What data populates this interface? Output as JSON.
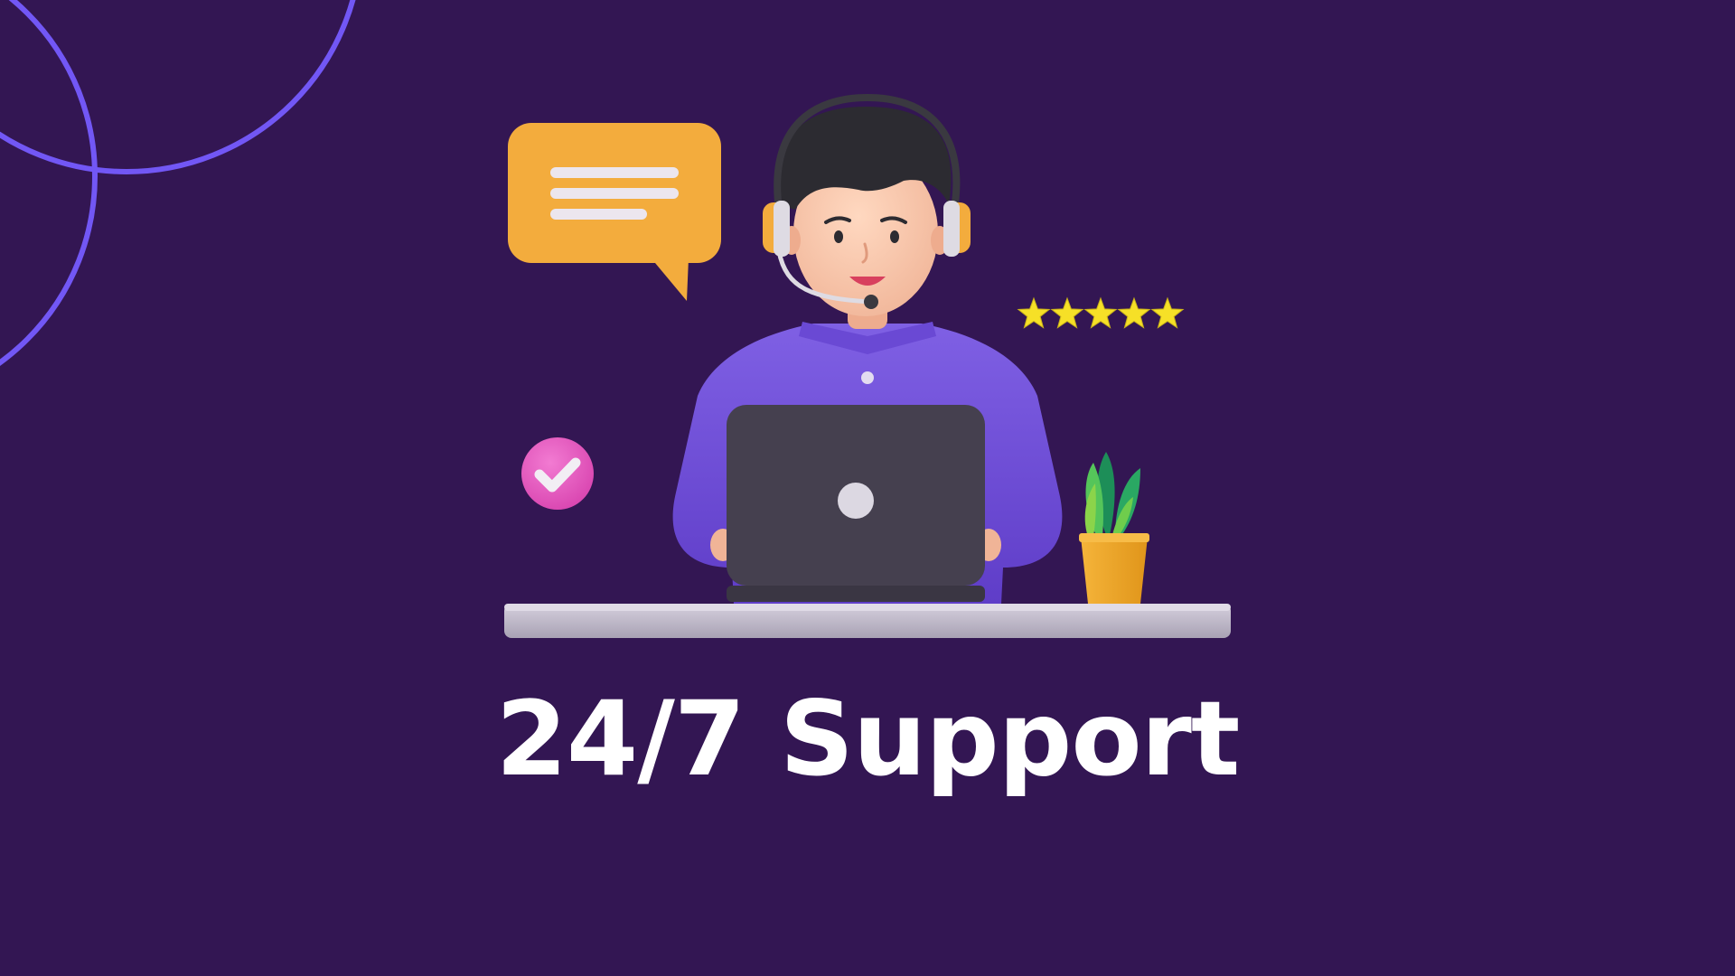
{
  "headline": "24/7 Support",
  "rating": {
    "value": 5,
    "max": 5
  },
  "icons": {
    "chat": "chat-bubble-icon",
    "check": "check-badge-icon",
    "star": "star-icon"
  },
  "colors": {
    "background": "#331653",
    "deco_arcs": "#7257f5",
    "chat_bubble": "#f3ac3d",
    "check_badge": "#e35bc0",
    "star": "#f6e027",
    "shirt": "#7352d8",
    "laptop": "#45404f",
    "desk": "#bfb9c8",
    "plant_pot": "#f2a826",
    "plant_leaves": "#3cb659",
    "headset_accent": "#f3ac3d",
    "headline_text": "#ffffff"
  }
}
